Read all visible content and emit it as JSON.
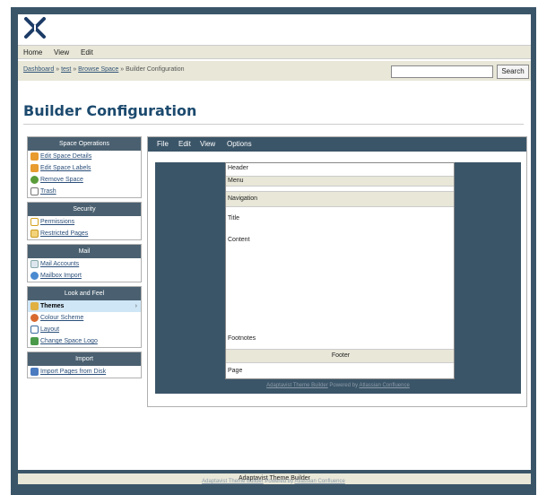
{
  "menubar": {
    "items": [
      "Home",
      "View",
      "Edit"
    ]
  },
  "breadcrumb": {
    "links": [
      "Dashboard",
      "test",
      "Browse Space"
    ],
    "current": "Builder Configuration",
    "separator": "»"
  },
  "search": {
    "value": "",
    "button_label": "Search"
  },
  "page_title": "Builder Configuration",
  "sidebar": {
    "sections": [
      {
        "title": "Space Operations",
        "items": [
          {
            "label": "Edit Space Details",
            "icon": "pencil-icon"
          },
          {
            "label": "Edit Space Labels",
            "icon": "pencil-icon"
          },
          {
            "label": "Remove Space",
            "icon": "remove-icon"
          },
          {
            "label": "Trash",
            "icon": "trash-icon"
          }
        ]
      },
      {
        "title": "Security",
        "items": [
          {
            "label": "Permissions",
            "icon": "lock-icon"
          },
          {
            "label": "Restricted Pages",
            "icon": "restricted-page-icon"
          }
        ]
      },
      {
        "title": "Mail",
        "items": [
          {
            "label": "Mail Accounts",
            "icon": "mail-icon"
          },
          {
            "label": "Mailbox Import",
            "icon": "mailbox-import-icon"
          }
        ]
      },
      {
        "title": "Look and Feel",
        "items": [
          {
            "label": "Themes",
            "icon": "themes-icon",
            "active": true
          },
          {
            "label": "Colour Scheme",
            "icon": "palette-icon"
          },
          {
            "label": "Layout",
            "icon": "layout-icon"
          },
          {
            "label": "Change Space Logo",
            "icon": "logo-icon"
          }
        ]
      },
      {
        "title": "Import",
        "items": [
          {
            "label": "Import Pages from Disk",
            "icon": "import-icon"
          }
        ]
      }
    ]
  },
  "builder": {
    "menu": [
      "File",
      "Edit",
      "View",
      "Options"
    ],
    "preview": {
      "header": "Header",
      "menu": "Menu",
      "navigation": "Navigation",
      "title": "Title",
      "content": "Content",
      "footnotes": "Footnotes",
      "footer": "Footer",
      "page": "Page"
    },
    "footer_link": "Adaptavist Theme Builder",
    "footer_text": "Powered by",
    "footer_link2": "Atlassian Confluence"
  },
  "page_footer": "Adaptavist Theme Builder",
  "bottom_footer": {
    "link": "Adaptavist Theme Builder",
    "text": "Powered by",
    "link2": "Atlassian Confluence"
  },
  "colors": {
    "frame": "#3b5568",
    "accent": "#1c4a6e",
    "bar": "#e8e7d8",
    "link": "#2b4f7a"
  }
}
